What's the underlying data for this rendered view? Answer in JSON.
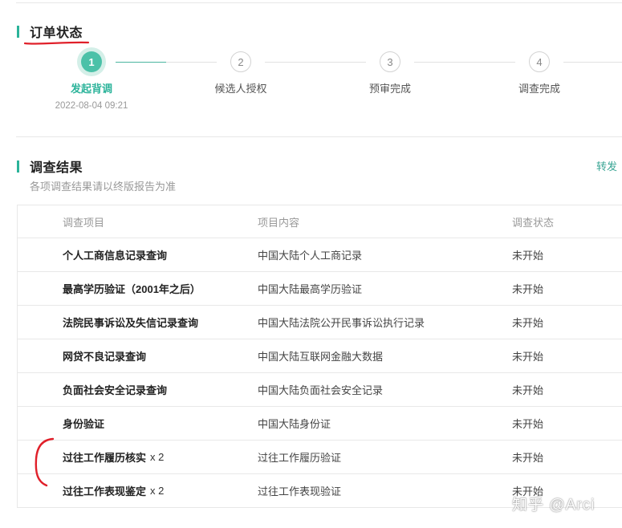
{
  "order_status": {
    "title": "订单状态",
    "steps": [
      {
        "number": "1",
        "label": "发起背调",
        "date": "2022-08-04 09:21",
        "active": true
      },
      {
        "number": "2",
        "label": "候选人授权",
        "date": "",
        "active": false
      },
      {
        "number": "3",
        "label": "预审完成",
        "date": "",
        "active": false
      },
      {
        "number": "4",
        "label": "调查完成",
        "date": "",
        "active": false
      }
    ]
  },
  "investigation_results": {
    "title": "调查结果",
    "subtitle": "各项调查结果请以终版报告为准",
    "forward_link": "转发",
    "columns": [
      "调查项目",
      "项目内容",
      "调查状态"
    ],
    "rows": [
      {
        "item": "个人工商信息记录查询",
        "count": "",
        "content": "中国大陆个人工商记录",
        "status": "未开始"
      },
      {
        "item": "最高学历验证（2001年之后）",
        "count": "",
        "content": "中国大陆最高学历验证",
        "status": "未开始"
      },
      {
        "item": "法院民事诉讼及失信记录查询",
        "count": "",
        "content": "中国大陆法院公开民事诉讼执行记录",
        "status": "未开始"
      },
      {
        "item": "网贷不良记录查询",
        "count": "",
        "content": "中国大陆互联网金融大数据",
        "status": "未开始"
      },
      {
        "item": "负面社会安全记录查询",
        "count": "",
        "content": "中国大陆负面社会安全记录",
        "status": "未开始"
      },
      {
        "item": "身份验证",
        "count": "",
        "content": "中国大陆身份证",
        "status": "未开始"
      },
      {
        "item": "过往工作履历核实",
        "count": "x 2",
        "content": "过往工作履历验证",
        "status": "未开始"
      },
      {
        "item": "过往工作表现鉴定",
        "count": "x 2",
        "content": "过往工作表现验证",
        "status": "未开始"
      }
    ]
  },
  "watermark": "知乎 @Arci",
  "colors": {
    "accent": "#2bb39a",
    "active_step": "#4bc1a8",
    "annotation": "#e0202a"
  }
}
